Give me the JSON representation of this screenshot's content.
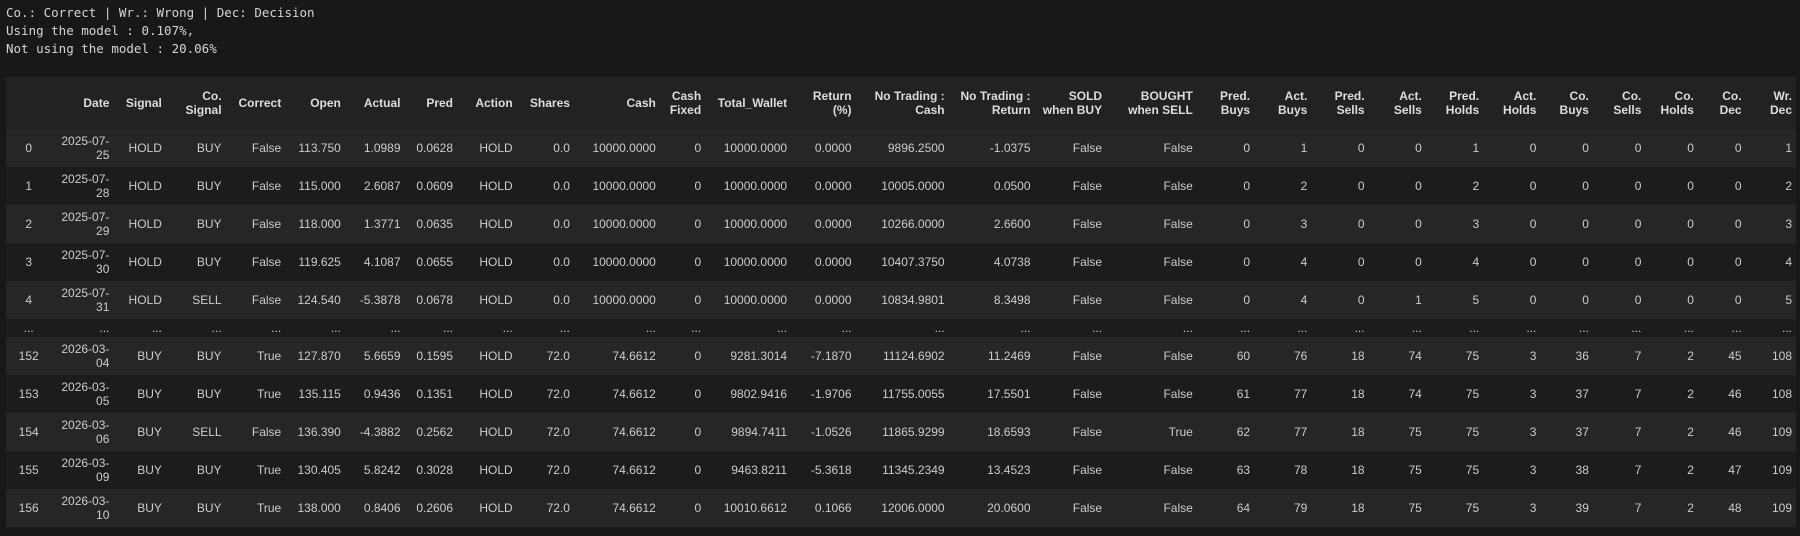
{
  "legend_line": "Co.: Correct | Wr.: Wrong | Dec: Decision",
  "model_line": "Using the model : 0.107%,",
  "nomodel_line": "Not using the model : 20.06%",
  "table": {
    "columns": [
      "",
      "Date",
      "Signal",
      "Co. Signal",
      "Correct",
      "Open",
      "Actual",
      "Pred",
      "Action",
      "Shares",
      "Cash",
      "Cash Fixed",
      "Total_Wallet",
      "Return (%)",
      "No Trading : Cash",
      "No Trading : Return",
      "SOLD when BUY",
      "BOUGHT when SELL",
      "Pred. Buys",
      "Act. Buys",
      "Pred. Sells",
      "Act. Sells",
      "Pred. Holds",
      "Act. Holds",
      "Co. Buys",
      "Co. Sells",
      "Co. Holds",
      "Co. Dec",
      "Wr. Dec"
    ],
    "rows": [
      [
        "0",
        "2025-07-25",
        "HOLD",
        "BUY",
        "False",
        "113.750",
        "1.0989",
        "0.0628",
        "HOLD",
        "0.0",
        "10000.0000",
        "0",
        "10000.0000",
        "0.0000",
        "9896.2500",
        "-1.0375",
        "False",
        "False",
        "0",
        "1",
        "0",
        "0",
        "1",
        "0",
        "0",
        "0",
        "0",
        "0",
        "1"
      ],
      [
        "1",
        "2025-07-28",
        "HOLD",
        "BUY",
        "False",
        "115.000",
        "2.6087",
        "0.0609",
        "HOLD",
        "0.0",
        "10000.0000",
        "0",
        "10000.0000",
        "0.0000",
        "10005.0000",
        "0.0500",
        "False",
        "False",
        "0",
        "2",
        "0",
        "0",
        "2",
        "0",
        "0",
        "0",
        "0",
        "0",
        "2"
      ],
      [
        "2",
        "2025-07-29",
        "HOLD",
        "BUY",
        "False",
        "118.000",
        "1.3771",
        "0.0635",
        "HOLD",
        "0.0",
        "10000.0000",
        "0",
        "10000.0000",
        "0.0000",
        "10266.0000",
        "2.6600",
        "False",
        "False",
        "0",
        "3",
        "0",
        "0",
        "3",
        "0",
        "0",
        "0",
        "0",
        "0",
        "3"
      ],
      [
        "3",
        "2025-07-30",
        "HOLD",
        "BUY",
        "False",
        "119.625",
        "4.1087",
        "0.0655",
        "HOLD",
        "0.0",
        "10000.0000",
        "0",
        "10000.0000",
        "0.0000",
        "10407.3750",
        "4.0738",
        "False",
        "False",
        "0",
        "4",
        "0",
        "0",
        "4",
        "0",
        "0",
        "0",
        "0",
        "0",
        "4"
      ],
      [
        "4",
        "2025-07-31",
        "HOLD",
        "SELL",
        "False",
        "124.540",
        "-5.3878",
        "0.0678",
        "HOLD",
        "0.0",
        "10000.0000",
        "0",
        "10000.0000",
        "0.0000",
        "10834.9801",
        "8.3498",
        "False",
        "False",
        "0",
        "4",
        "0",
        "1",
        "5",
        "0",
        "0",
        "0",
        "0",
        "0",
        "5"
      ],
      [
        "...",
        "...",
        "...",
        "...",
        "...",
        "...",
        "...",
        "...",
        "...",
        "...",
        "...",
        "...",
        "...",
        "...",
        "...",
        "...",
        "...",
        "...",
        "...",
        "...",
        "...",
        "...",
        "...",
        "...",
        "...",
        "...",
        "...",
        "...",
        "..."
      ],
      [
        "152",
        "2026-03-04",
        "BUY",
        "BUY",
        "True",
        "127.870",
        "5.6659",
        "0.1595",
        "HOLD",
        "72.0",
        "74.6612",
        "0",
        "9281.3014",
        "-7.1870",
        "11124.6902",
        "11.2469",
        "False",
        "False",
        "60",
        "76",
        "18",
        "74",
        "75",
        "3",
        "36",
        "7",
        "2",
        "45",
        "108"
      ],
      [
        "153",
        "2026-03-05",
        "BUY",
        "BUY",
        "True",
        "135.115",
        "0.9436",
        "0.1351",
        "HOLD",
        "72.0",
        "74.6612",
        "0",
        "9802.9416",
        "-1.9706",
        "11755.0055",
        "17.5501",
        "False",
        "False",
        "61",
        "77",
        "18",
        "74",
        "75",
        "3",
        "37",
        "7",
        "2",
        "46",
        "108"
      ],
      [
        "154",
        "2026-03-06",
        "BUY",
        "SELL",
        "False",
        "136.390",
        "-4.3882",
        "0.2562",
        "HOLD",
        "72.0",
        "74.6612",
        "0",
        "9894.7411",
        "-1.0526",
        "11865.9299",
        "18.6593",
        "False",
        "True",
        "62",
        "77",
        "18",
        "75",
        "75",
        "3",
        "37",
        "7",
        "2",
        "46",
        "109"
      ],
      [
        "155",
        "2026-03-09",
        "BUY",
        "BUY",
        "True",
        "130.405",
        "5.8242",
        "0.3028",
        "HOLD",
        "72.0",
        "74.6612",
        "0",
        "9463.8211",
        "-5.3618",
        "11345.2349",
        "13.4523",
        "False",
        "False",
        "63",
        "78",
        "18",
        "75",
        "75",
        "3",
        "38",
        "7",
        "2",
        "47",
        "109"
      ],
      [
        "156",
        "2026-03-10",
        "BUY",
        "BUY",
        "True",
        "138.000",
        "0.8406",
        "0.2606",
        "HOLD",
        "72.0",
        "74.6612",
        "0",
        "10010.6612",
        "0.1066",
        "12006.0000",
        "20.0600",
        "False",
        "False",
        "64",
        "79",
        "18",
        "75",
        "75",
        "3",
        "39",
        "7",
        "2",
        "48",
        "109"
      ]
    ]
  }
}
